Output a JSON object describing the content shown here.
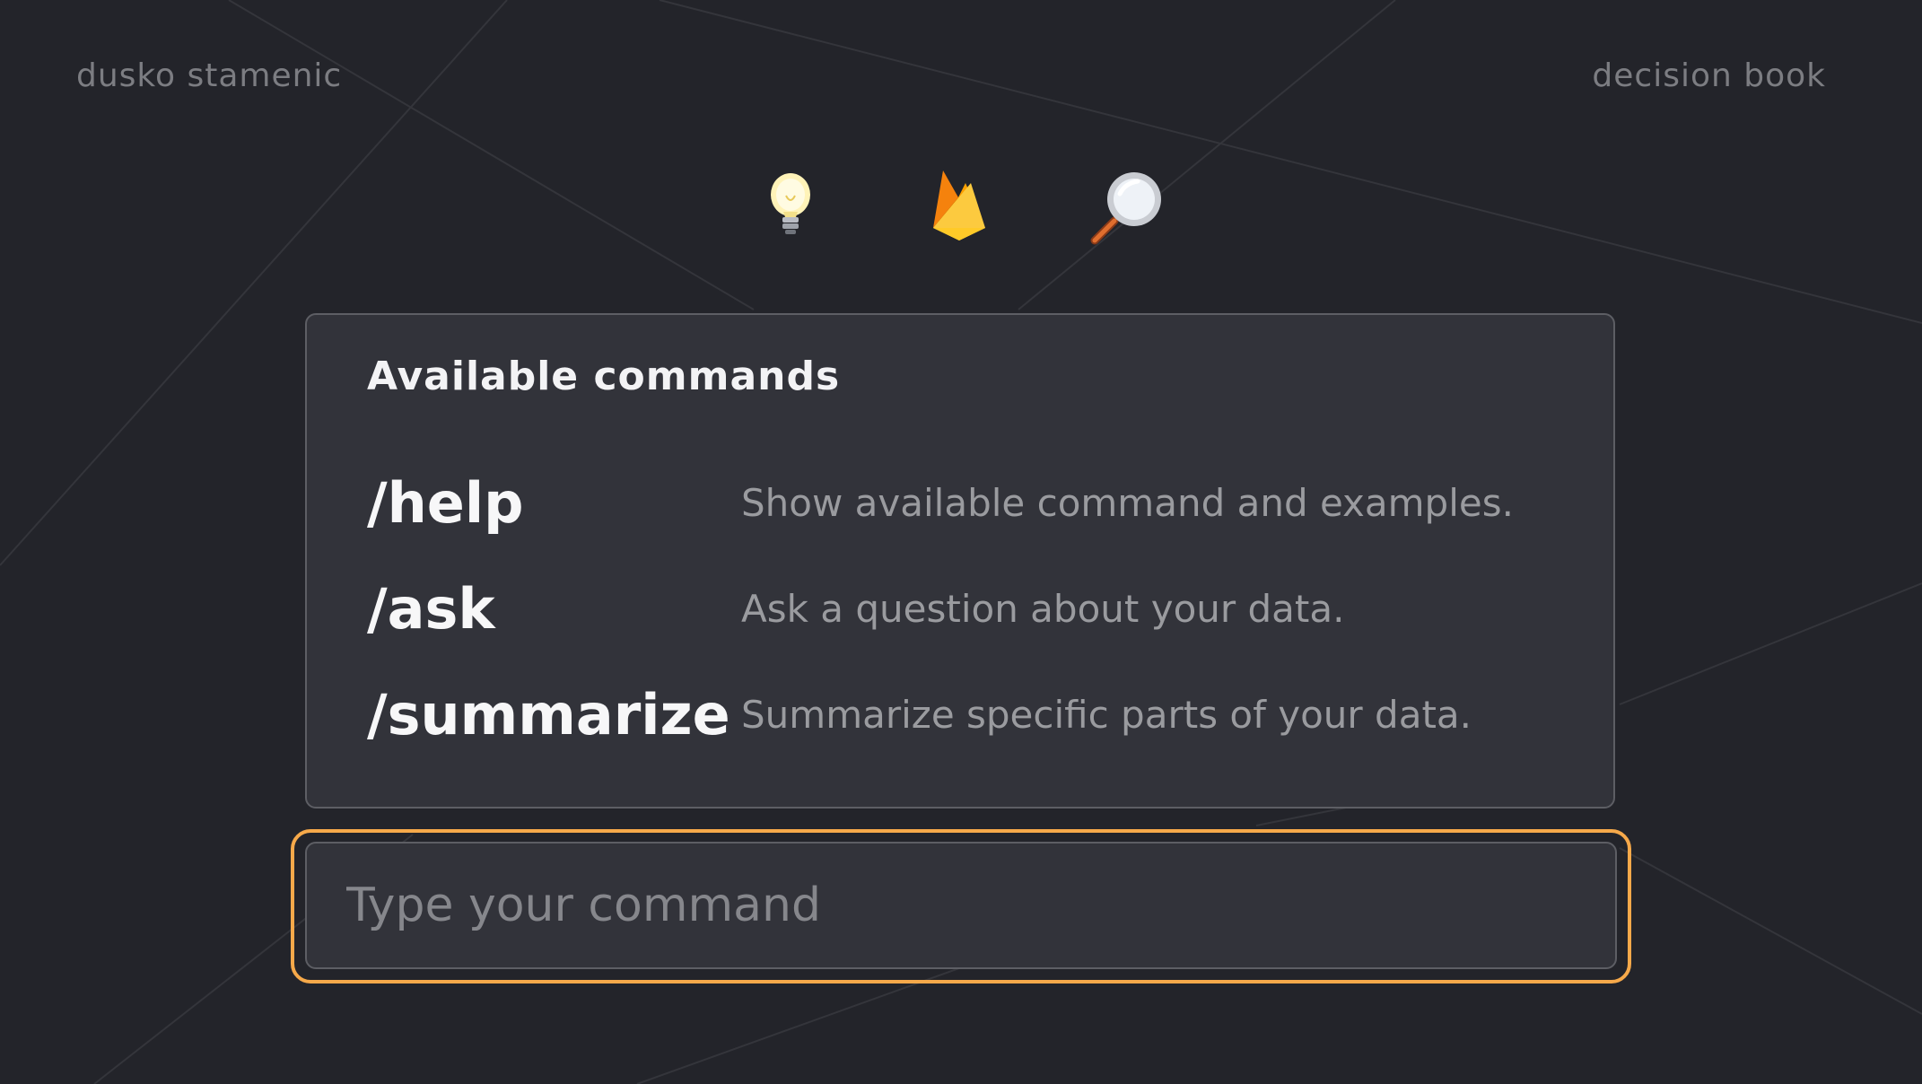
{
  "header": {
    "author": "dusko stamenic",
    "book": "decision book"
  },
  "icons": [
    {
      "name": "light-bulb-icon"
    },
    {
      "name": "fire-icon"
    },
    {
      "name": "magnifier-icon"
    }
  ],
  "commands_panel": {
    "title": "Available commands",
    "commands": [
      {
        "name": "/help",
        "description": "Show available command and examples."
      },
      {
        "name": "/ask",
        "description": "Ask a question about your data."
      },
      {
        "name": "/summarize",
        "description": "Summarize specific parts of your data."
      }
    ]
  },
  "command_input": {
    "placeholder": "Type your command",
    "value": ""
  },
  "colors": {
    "background": "#23242a",
    "panel": "#32333a",
    "focus_ring": "#f6a94a"
  }
}
